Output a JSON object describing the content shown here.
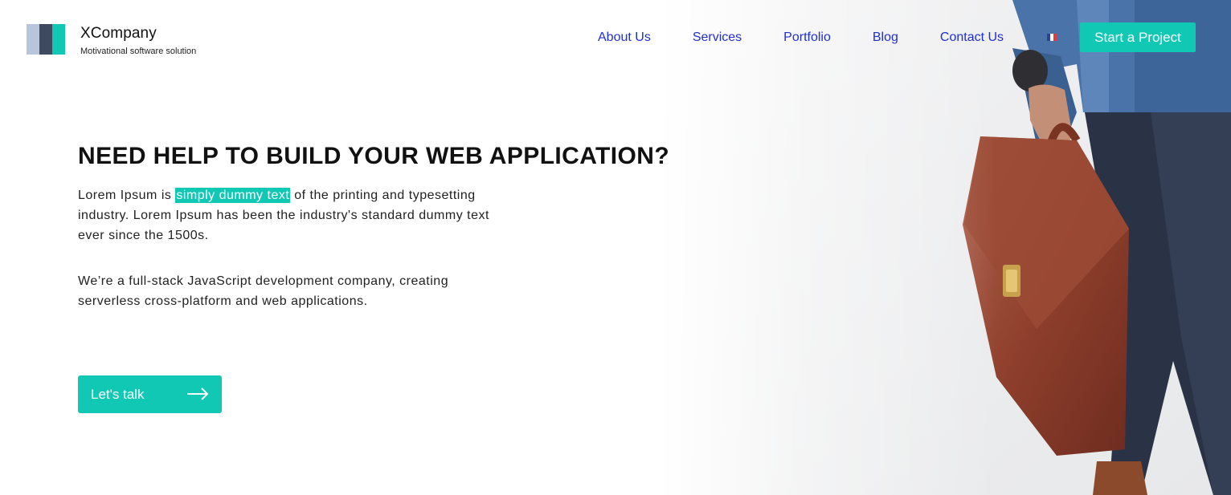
{
  "header": {
    "brand_name": "XCompany",
    "brand_tagline": "Motivational software solution",
    "nav": [
      {
        "label": "About Us"
      },
      {
        "label": "Services"
      },
      {
        "label": "Portfolio"
      },
      {
        "label": "Blog"
      },
      {
        "label": "Contact Us"
      }
    ],
    "language_flag": "french-flag-icon",
    "cta_label": "Start a Project"
  },
  "hero": {
    "headline": "NEED HELP TO BUILD YOUR WEB APPLICATION?",
    "para1_before": "Lorem Ipsum is ",
    "para1_highlight": "simply dummy text",
    "para1_after": " of the printing and typesetting industry. Lorem Ipsum has been the industry's standard dummy text ever since the 1500s.",
    "para2": "We’re a full-stack JavaScript development company, creating serverless cross-platform and web applications.",
    "cta_label": "Let's talk",
    "cta_icon": "arrow-right-icon"
  },
  "colors": {
    "accent": "#11c8b4",
    "nav_link": "#1f2fd6",
    "logo_light": "#b8c6dc",
    "logo_dark": "#3e4a5f"
  }
}
